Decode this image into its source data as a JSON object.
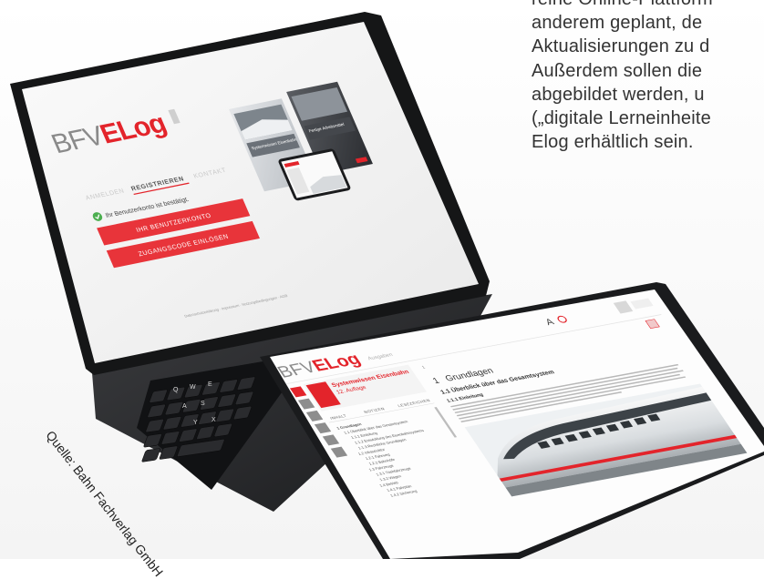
{
  "article_text": {
    "lines": [
      "reine Online-Plattform",
      "anderem geplant, de",
      "Aktualisierungen zu d",
      "Außerdem sollen die",
      "abgebildet werden, u",
      "(„digitale Lerneinheite",
      "Elog erhältlich sein."
    ]
  },
  "credit": "Quelle: Bahn Fachverlag GmbH",
  "laptop_screen": {
    "logo_prefix": "BFV",
    "logo_suffix": "ELog",
    "tabs": [
      "ANMELDEN",
      "REGISTRIEREN",
      "KONTAKT"
    ],
    "confirmation": "Ihr Benutzerkonto ist bestätigt.",
    "account_button": "IHR BENUTZERKONTO",
    "code_button": "ZUGANGSCODE EINLÖSEN",
    "book_left_title": "Systemwissen Eisenbahn",
    "book_right_title": "Fertige Arbeitsmittel",
    "footer": "Datenschutzerklärung · Impressum · Nutzungsbedingungen · AGB"
  },
  "tablet_screen": {
    "logo_prefix": "BFV",
    "logo_suffix": "ELog",
    "header_tab": "Ausgaben",
    "book_title": "Systemwissen Eisenbahn",
    "edition": "12. Auflage",
    "sidebar_tabs": [
      "INHALT",
      "NOTIZEN",
      "LESEZEICHEN"
    ],
    "toc": [
      "1 Grundlagen",
      "1.1 Überblick über das Gesamtsystem",
      "1.1.1 Einleitung",
      "1.1.2 Entwicklung des Eisenbahnsystems",
      "1.1.3 Rechtliche Grundlagen",
      "1.2 Infrastruktur",
      "1.2.1 Fahrweg",
      "1.2.2 Bahnhöfe",
      "1.3 Fahrzeuge",
      "1.3.1 Triebfahrzeuge",
      "1.3.2 Wagen",
      "1.4 Betrieb",
      "1.4.1 Fahrplan",
      "1.4.2 Sicherung"
    ],
    "page_indicator": "1",
    "chapter_number": "1",
    "chapter_title": "Grundlagen",
    "section_title": "1.1  Überblick über das Gesamtsystem",
    "subsection_title": "1.1.1  Einleitung",
    "font_toggle": "A",
    "colors": {
      "brand_red": "#e3242b",
      "button_red": "#e8343a"
    }
  }
}
